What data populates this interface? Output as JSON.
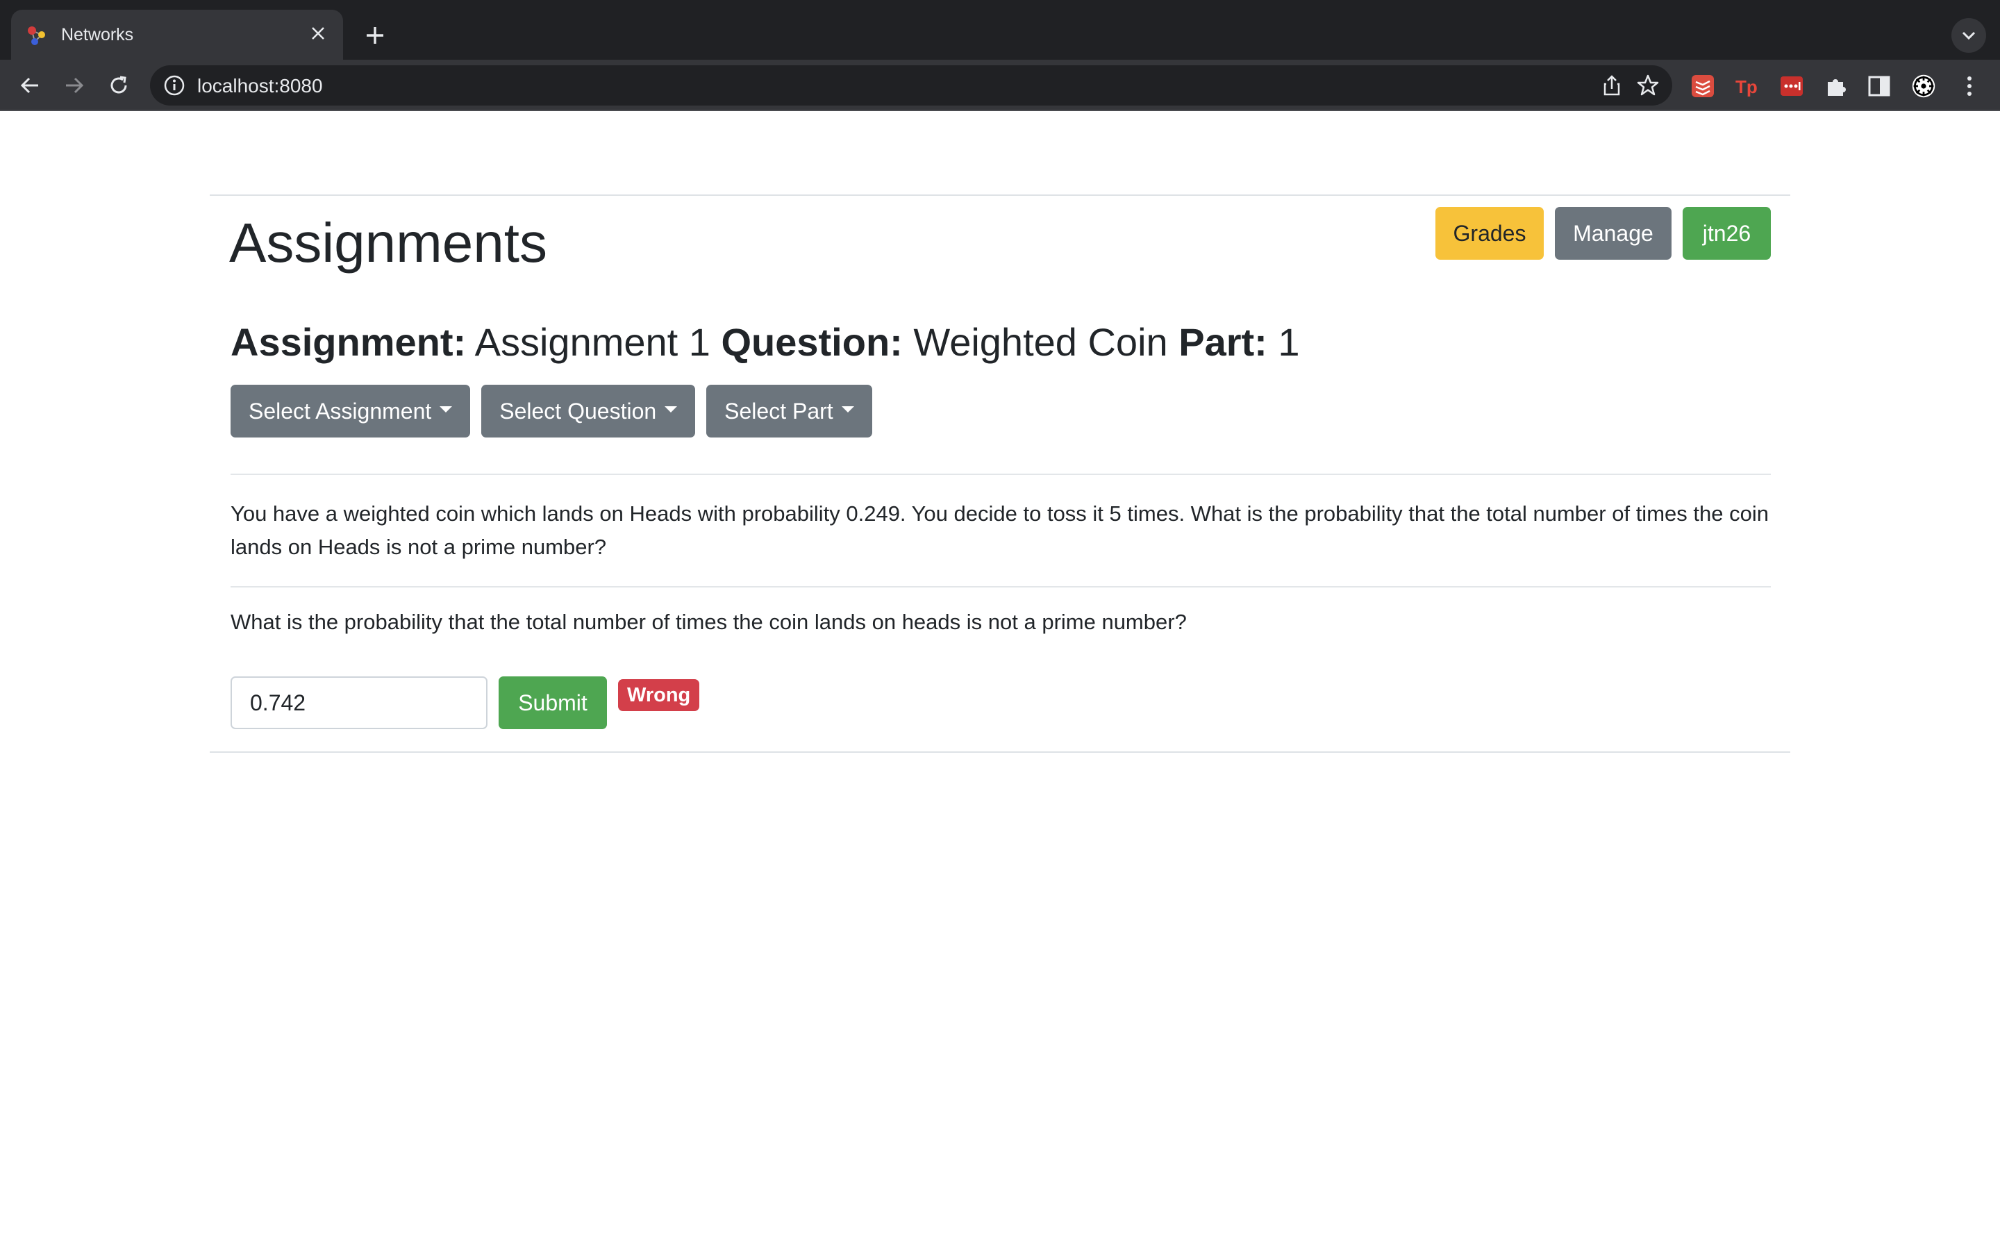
{
  "browser": {
    "tab_title": "Networks",
    "new_tab_label": "+",
    "url": "localhost:8080"
  },
  "page": {
    "title": "Assignments",
    "top_buttons": {
      "grades": "Grades",
      "manage": "Manage",
      "user": "jtn26"
    },
    "heading": {
      "assignment_label": "Assignment:",
      "assignment_value": "Assignment 1",
      "question_label": "Question:",
      "question_value": "Weighted Coin",
      "part_label": "Part:",
      "part_value": "1"
    },
    "dropdowns": {
      "assignment": "Select Assignment",
      "question": "Select Question",
      "part": "Select Part"
    },
    "question_text": "You have a weighted coin which lands on Heads with probability 0.249. You decide to toss it 5 times. What is the probability that the total number of times the coin lands on Heads is not a prime number?",
    "part_question": "What is the probability that the total number of times the coin lands on heads is not a prime number?",
    "answer": {
      "value": "0.742",
      "submit_label": "Submit",
      "result_badge": "Wrong"
    }
  },
  "colors": {
    "warning": "#f7c23a",
    "secondary": "#6c757d",
    "success": "#4ea651",
    "danger": "#d33f4a"
  }
}
